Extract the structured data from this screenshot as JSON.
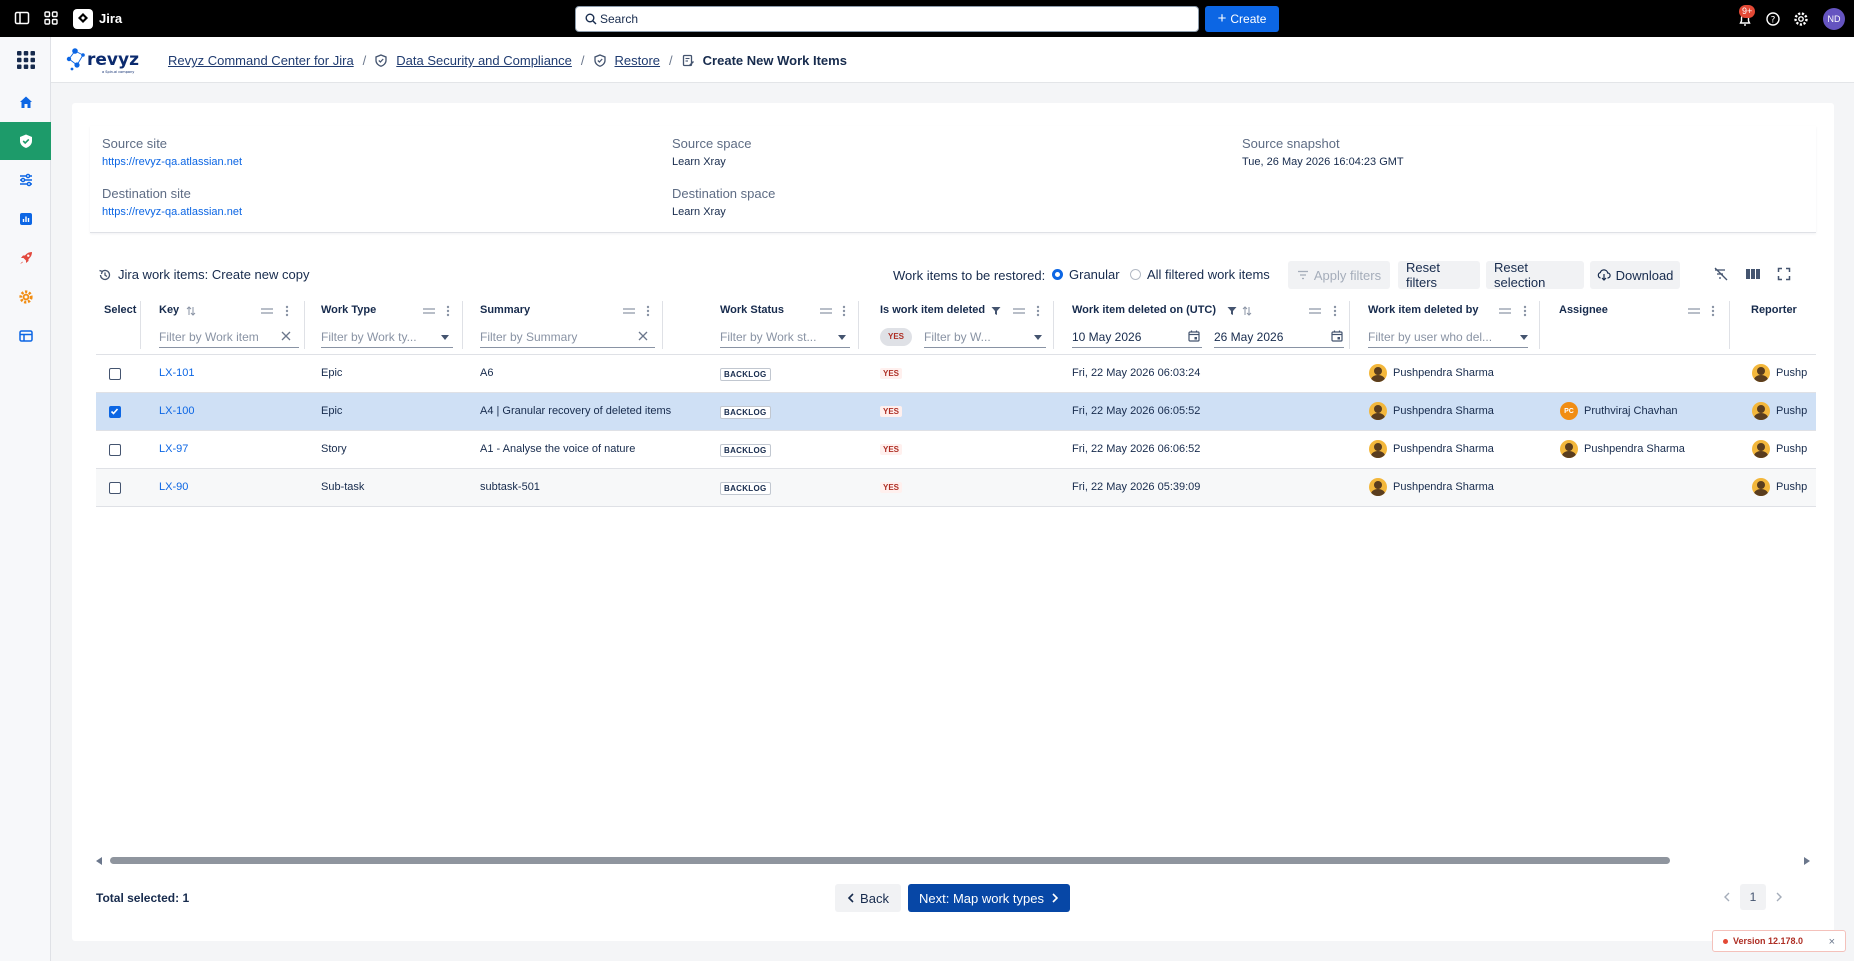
{
  "topbar": {
    "app_name": "Jira",
    "search_placeholder": "Search",
    "create_label": "Create",
    "notification_count": "9+",
    "user_initials": "ND"
  },
  "header": {
    "breadcrumbs": [
      {
        "label": "Revyz Command Center for Jira"
      },
      {
        "label": "Data Security and Compliance"
      },
      {
        "label": "Restore"
      },
      {
        "label": "Create New Work Items"
      }
    ]
  },
  "info": {
    "source_site_label": "Source site",
    "source_site_value": "https://revyz-qa.atlassian.net",
    "destination_site_label": "Destination site",
    "destination_site_value": "https://revyz-qa.atlassian.net",
    "source_space_label": "Source space",
    "source_space_value": "Learn Xray",
    "destination_space_label": "Destination space",
    "destination_space_value": "Learn Xray",
    "source_snapshot_label": "Source snapshot",
    "source_snapshot_value": "Tue, 26 May 2026 16:04:23 GMT"
  },
  "toolbar": {
    "title": "Jira work items: Create new copy",
    "restore_label": "Work items to be restored:",
    "option_granular": "Granular",
    "option_all": "All filtered work items",
    "apply_filters": "Apply filters",
    "reset_filters": "Reset filters",
    "reset_selection": "Reset selection",
    "download": "Download"
  },
  "table": {
    "columns": {
      "select": "Select",
      "key": "Key",
      "work_type": "Work Type",
      "summary": "Summary",
      "work_status": "Work Status",
      "is_deleted": "Is work item deleted",
      "deleted_on": "Work item deleted on (UTC)",
      "deleted_by": "Work item deleted by",
      "assignee": "Assignee",
      "reporter": "Reporter"
    },
    "filters": {
      "key_placeholder": "Filter by Work item",
      "work_type_placeholder": "Filter by Work ty...",
      "summary_placeholder": "Filter by Summary",
      "work_status_placeholder": "Filter by Work st...",
      "is_deleted_chip": "YES",
      "is_deleted_placeholder": "Filter by W...",
      "date_from": "10 May 2026",
      "date_to": "26 May 2026",
      "deleted_by_placeholder": "Filter by user who del..."
    },
    "rows": [
      {
        "key": "LX-101",
        "work_type": "Epic",
        "summary": "A6",
        "status": "BACKLOG",
        "deleted": "YES",
        "deleted_on": "Fri, 22 May 2026 06:03:24",
        "deleted_by": "Pushpendra Sharma",
        "assignee": "",
        "assignee_initials": "",
        "reporter": "Pushp",
        "selected": false
      },
      {
        "key": "LX-100",
        "work_type": "Epic",
        "summary": "A4 | Granular recovery of deleted items",
        "status": "BACKLOG",
        "deleted": "YES",
        "deleted_on": "Fri, 22 May 2026 06:05:52",
        "deleted_by": "Pushpendra Sharma",
        "assignee": "Pruthviraj Chavhan",
        "assignee_initials": "PC",
        "reporter": "Pushp",
        "selected": true
      },
      {
        "key": "LX-97",
        "work_type": "Story",
        "summary": "A1 - Analyse the voice of nature",
        "status": "BACKLOG",
        "deleted": "YES",
        "deleted_on": "Fri, 22 May 2026 06:06:52",
        "deleted_by": "Pushpendra Sharma",
        "assignee": "Pushpendra Sharma",
        "assignee_initials": "",
        "reporter": "Pushp",
        "selected": false
      },
      {
        "key": "LX-90",
        "work_type": "Sub-task",
        "summary": "subtask-501",
        "status": "BACKLOG",
        "deleted": "YES",
        "deleted_on": "Fri, 22 May 2026 05:39:09",
        "deleted_by": "Pushpendra Sharma",
        "assignee": "",
        "assignee_initials": "",
        "reporter": "Pushp",
        "selected": false
      }
    ]
  },
  "footer": {
    "total_selected": "Total selected: 1",
    "back_label": "Back",
    "next_label": "Next: Map work types",
    "page": "1"
  },
  "version": "Version 12.178.0",
  "colors": {
    "accent": "#0c66e4",
    "primary_dark": "#0747a6",
    "nav_active": "#1d9b6a",
    "selected_row": "#cfe0f5"
  }
}
